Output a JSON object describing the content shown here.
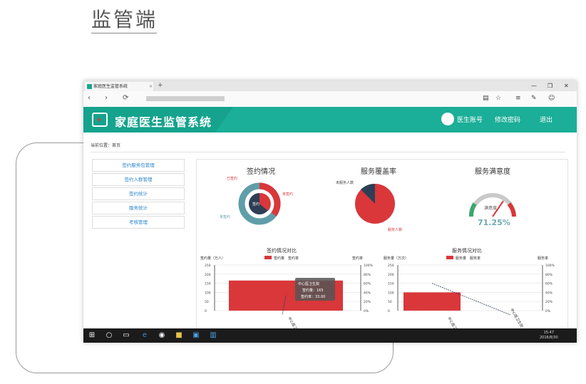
{
  "heading": "监管端",
  "browser": {
    "tab_title": "家庭医生监管系统",
    "tab_close": "×",
    "new_tab": "+",
    "window_controls": [
      "—",
      "❐",
      "✕"
    ],
    "nav": [
      "‹",
      "›",
      "⟳"
    ],
    "toolbar_icons": [
      "▤",
      "☆",
      "≡",
      "✎",
      "☺"
    ]
  },
  "app": {
    "title": "家庭医生监管系统",
    "nav": [
      "医生账号",
      "修改密码",
      "退出"
    ]
  },
  "breadcrumb": "当前位置：首页",
  "menu": [
    "签约服务包管理",
    "签约人群管理",
    "签约统计",
    "服务统计",
    "考核管理"
  ],
  "charts": {
    "signing_title": "签约情况",
    "coverage_title": "服务覆盖率",
    "satisfaction_title": "服务满意度",
    "gauge_value": "71.25%",
    "gauge_label": "满意度",
    "signing_compare_title": "签约情况对比",
    "service_compare_title": "服务情况对比",
    "donut_labels": [
      "已签约",
      "未签约",
      "签约",
      "未签约"
    ],
    "pie_labels": [
      "未服务人数",
      "服务人数"
    ],
    "legend_signed": "签约量",
    "legend_rate": "签约率",
    "legend_service": "服务量",
    "legend_service_rate": "服务率",
    "y_left_1": "签约量（万人）",
    "y_right_1": "签约率",
    "y_left_2": "服务量（万次）",
    "y_right_2": "服务率",
    "tooltip_title": "中心医卫生院",
    "tooltip_line1": "签约量：165",
    "tooltip_line2": "签约率：33.00",
    "xcat_1": "中心医卫生院",
    "xcat_2": "中心医卫生院",
    "xcat_3": "中心医卫生院"
  },
  "chart_data": [
    {
      "type": "bar",
      "title": "签约情况对比",
      "categories": [
        "中心医卫生院"
      ],
      "series": [
        {
          "name": "签约量",
          "values": [
            165
          ]
        },
        {
          "name": "签约率",
          "values": [
            33
          ]
        }
      ],
      "ylabel": "签约量（万人）",
      "ylim": [
        0,
        250
      ],
      "y2label": "签约率",
      "y2lim": [
        0,
        100
      ]
    },
    {
      "type": "bar",
      "title": "服务情况对比",
      "categories": [
        "中心医卫生院"
      ],
      "series": [
        {
          "name": "服务量",
          "values": [
            100
          ]
        },
        {
          "name": "服务率",
          "values": [
            60
          ]
        }
      ],
      "ylabel": "服务量（万次）",
      "ylim": [
        0,
        250
      ],
      "y2label": "服务率",
      "y2lim": [
        0,
        100
      ]
    }
  ],
  "ticks_left": [
    "250",
    "200",
    "150",
    "100",
    "50",
    "0"
  ],
  "ticks_right": [
    "100%",
    "80%",
    "60%",
    "40%",
    "20%",
    "0%"
  ],
  "taskbar": {
    "time": "15:47",
    "date": "2016/8/30",
    "icons": [
      "⊞",
      "○",
      "▭",
      "e",
      "◉",
      "■",
      "▣",
      "▥"
    ]
  },
  "colors": {
    "teal": "#1bae98",
    "red": "#d9373a",
    "dark": "#2e3f55",
    "gauge_green": "#3aa76d"
  }
}
